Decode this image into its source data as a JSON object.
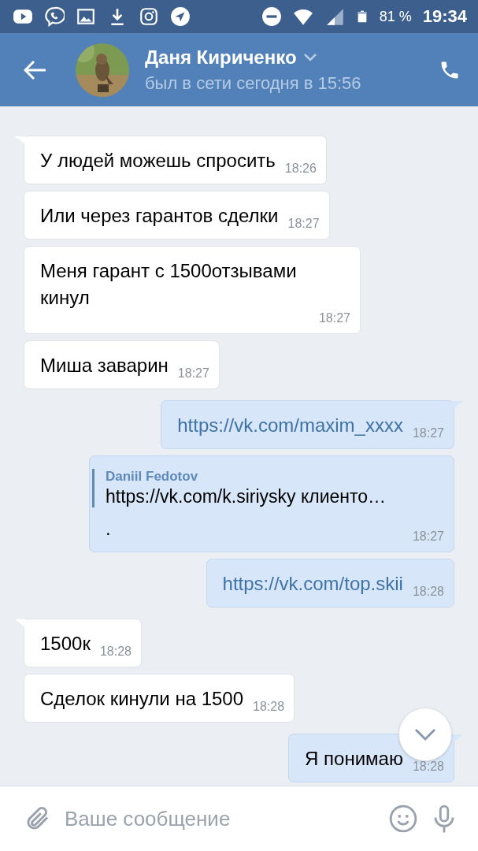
{
  "status_bar": {
    "battery": "81 %",
    "time": "19:34"
  },
  "header": {
    "name": "Даня Кириченко",
    "status": "был в сети сегодня в 15:56"
  },
  "messages": [
    {
      "kind": "in",
      "tail": true,
      "text": "У людей можешь спросить",
      "time": "18:26"
    },
    {
      "kind": "in",
      "tail": false,
      "text": "Или через гарантов сделки",
      "time": "18:27"
    },
    {
      "kind": "in",
      "tail": false,
      "text": "Меня гарант с 1500отзывами кинул",
      "time": "18:27"
    },
    {
      "kind": "in",
      "tail": false,
      "text": "Миша заварин",
      "time": "18:27"
    },
    {
      "kind": "out",
      "tail": true,
      "link": true,
      "text": "https://vk.com/maxim_xxxx",
      "time": "18:27"
    },
    {
      "kind": "out",
      "tail": false,
      "quote": {
        "author": "Daniil Fedotov",
        "text": "https://vk.com/k.siriysky клиенто…"
      },
      "text": ".",
      "time": "18:27"
    },
    {
      "kind": "out",
      "tail": false,
      "link": true,
      "text": "https://vk.com/top.skii",
      "time": "18:28"
    },
    {
      "kind": "in",
      "tail": true,
      "text": "1500к",
      "time": "18:28"
    },
    {
      "kind": "in",
      "tail": false,
      "text": "Сделок кинули на 1500",
      "time": "18:28"
    },
    {
      "kind": "out",
      "tail": true,
      "text": "Я понимаю",
      "time": "18:28"
    }
  ],
  "composer": {
    "placeholder": "Ваше сообщение"
  }
}
